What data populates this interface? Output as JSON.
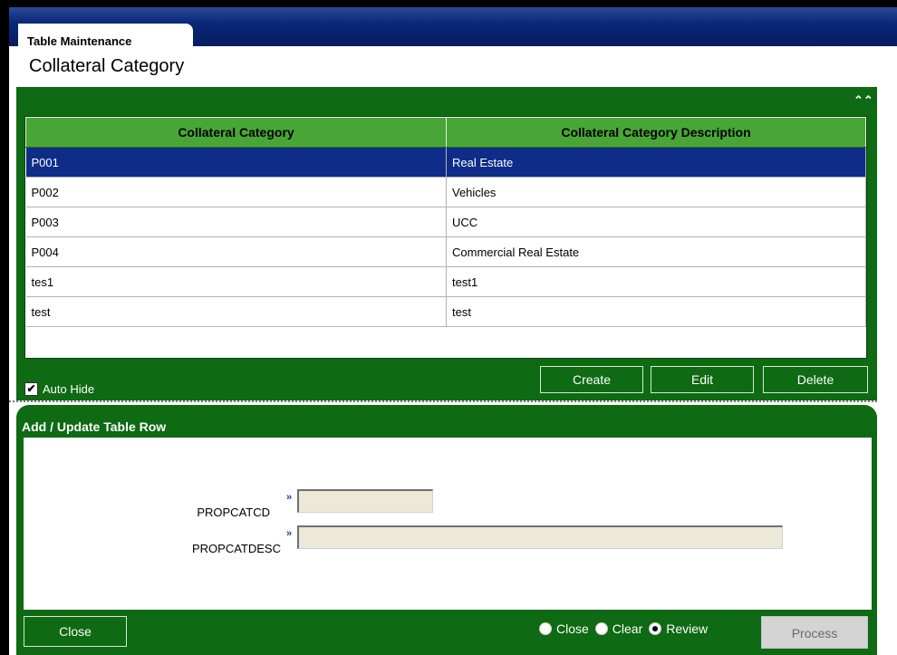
{
  "tab": {
    "label": "Table Maintenance"
  },
  "page": {
    "title": "Collateral Category"
  },
  "grid": {
    "columns": [
      "Collateral Category",
      "Collateral Category Description"
    ],
    "rows": [
      {
        "code": "P001",
        "description": "Real Estate",
        "selected": true
      },
      {
        "code": "P002",
        "description": "Vehicles",
        "selected": false
      },
      {
        "code": "P003",
        "description": "UCC",
        "selected": false
      },
      {
        "code": "P004",
        "description": "Commercial Real Estate",
        "selected": false
      },
      {
        "code": "tes1",
        "description": "test1",
        "selected": false
      },
      {
        "code": "test",
        "description": "test",
        "selected": false
      }
    ]
  },
  "auto_hide": {
    "label": "Auto Hide",
    "checked": true,
    "check_glyph": "✔"
  },
  "toolbar": {
    "create": "Create",
    "edit": "Edit",
    "delete": "Delete",
    "collapse_glyph": "⌃⌃"
  },
  "form": {
    "title": "Add / Update Table Row",
    "fields": [
      {
        "label": "PROPCATCD",
        "value": ""
      },
      {
        "label": "PROPCATDESC",
        "value": ""
      }
    ],
    "arrow_glyph": "»"
  },
  "footer": {
    "close_button": "Close",
    "radio_options": [
      {
        "label": "Close",
        "selected": false
      },
      {
        "label": "Clear",
        "selected": false
      },
      {
        "label": "Review",
        "selected": true
      }
    ],
    "process_button": "Process"
  },
  "colors": {
    "header_bar": "#0a2878",
    "panel_green": "#0e6a13",
    "grid_header": "#49a636",
    "selected_row": "#0d2d88"
  }
}
